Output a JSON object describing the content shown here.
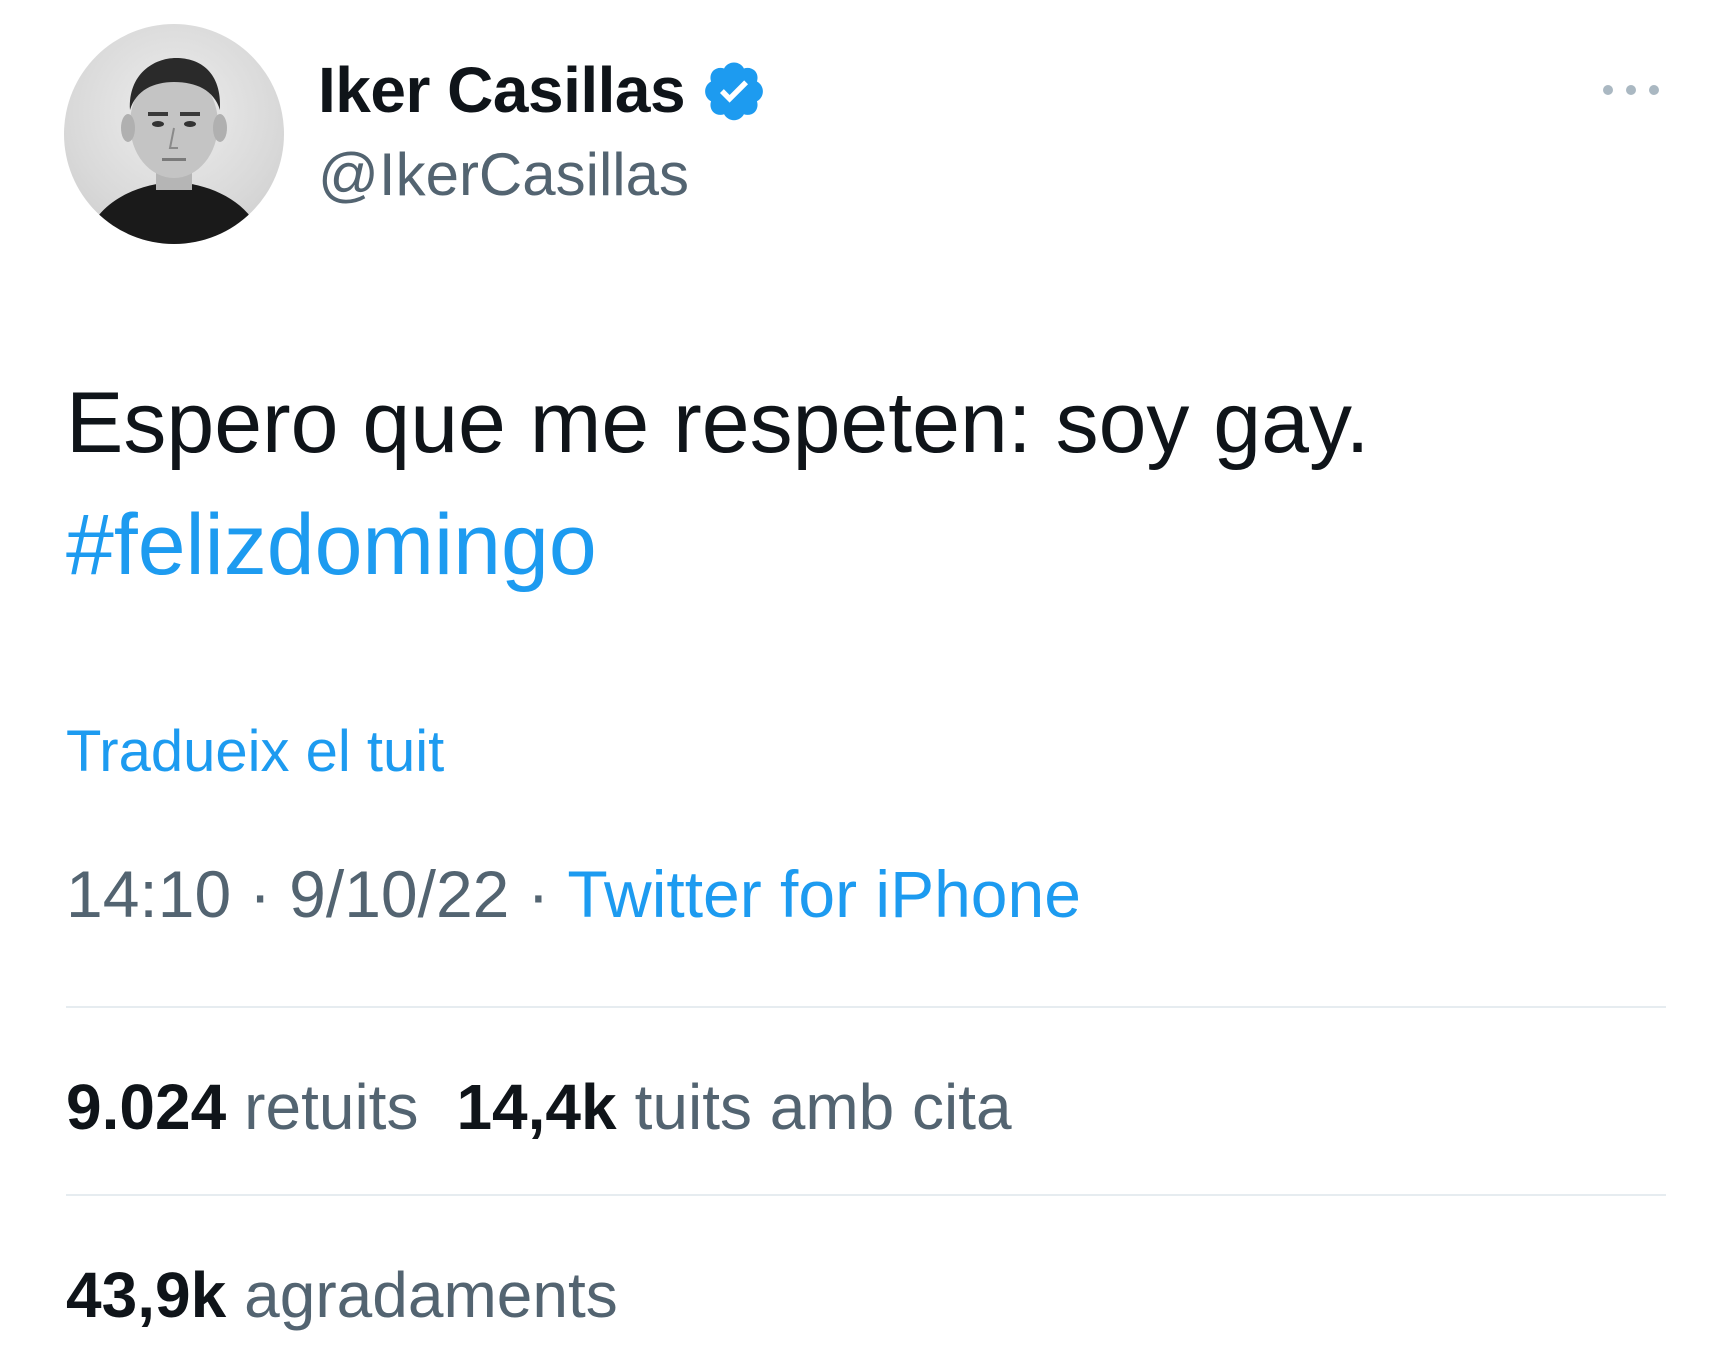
{
  "author": {
    "display_name": "Iker Casillas",
    "handle": "@IkerCasillas",
    "verified": true
  },
  "tweet": {
    "text": "Espero que me respeten: soy gay.",
    "hashtag": "#felizdomingo",
    "translate_label": "Tradueix el tuit",
    "time": "14:10",
    "separator": "·",
    "date": "9/10/22",
    "source": "Twitter for iPhone"
  },
  "stats": {
    "retweets_count": "9.024",
    "retweets_label": "retuits",
    "quotes_count": "14,4k",
    "quotes_label": "tuits amb cita",
    "likes_count": "43,9k",
    "likes_label": "agradaments"
  },
  "colors": {
    "link": "#1d9bf0",
    "secondary_text": "#536471",
    "primary_text": "#0f1419",
    "verified_badge": "#1d9bf0"
  },
  "icons": {
    "verified": "verified-badge-icon",
    "more": "more-options-icon"
  }
}
